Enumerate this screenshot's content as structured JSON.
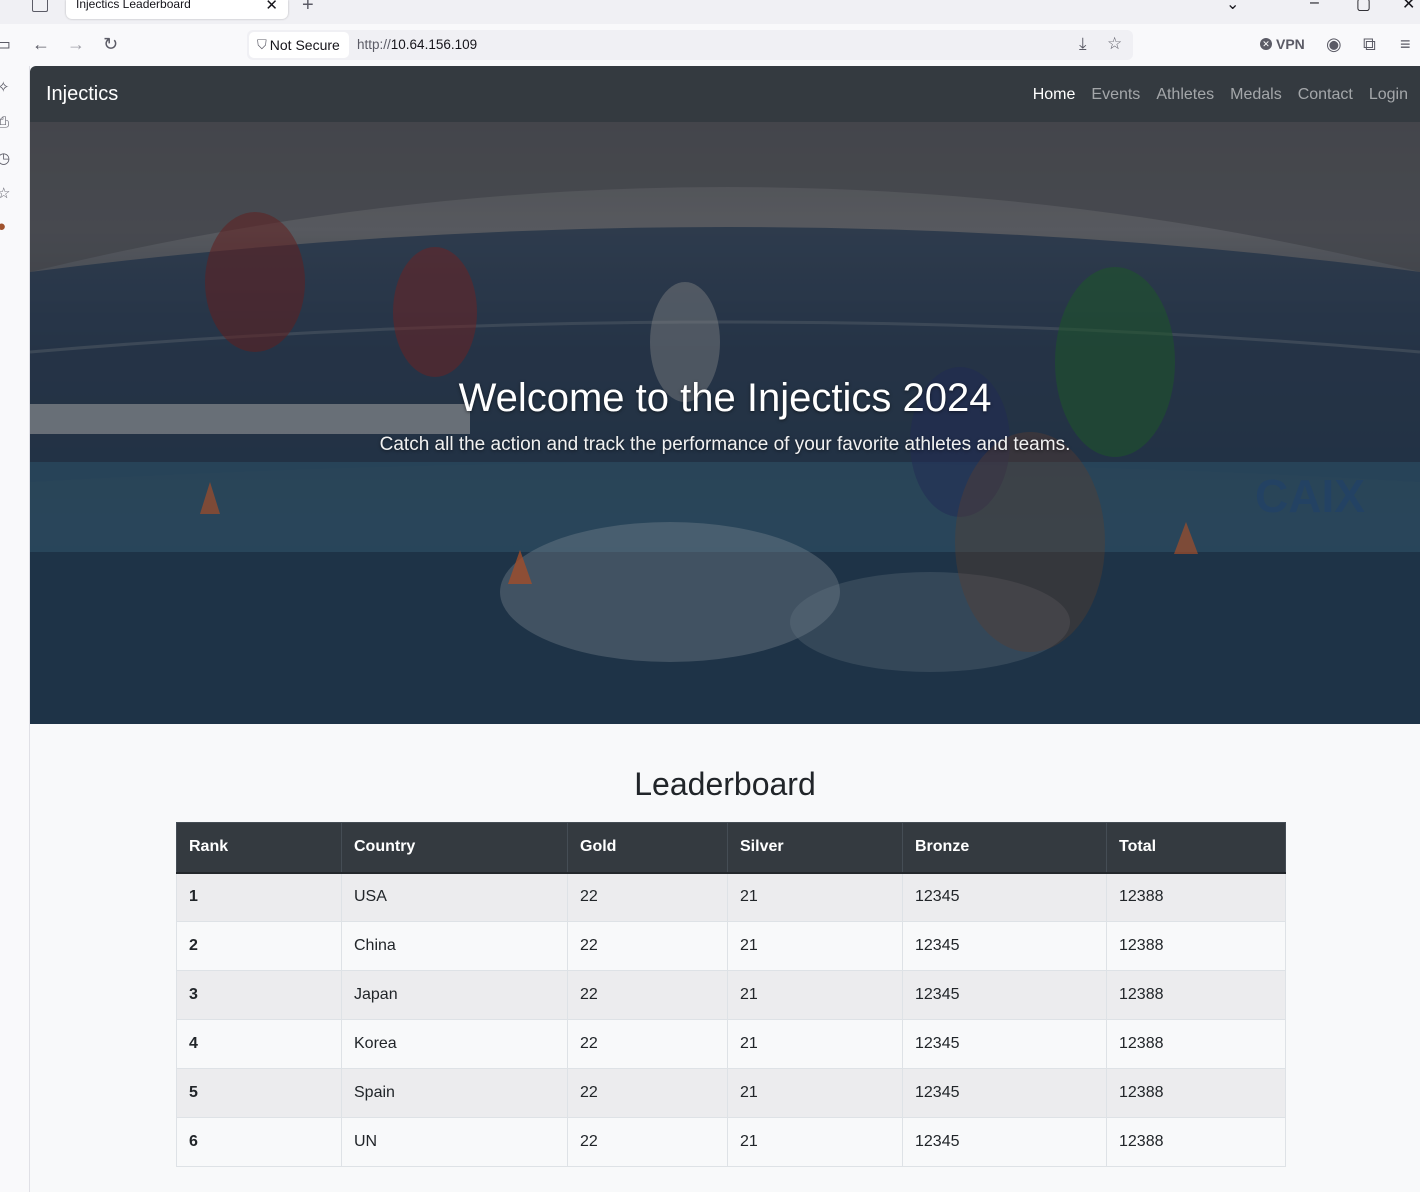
{
  "browser": {
    "tab_title": "Injectics Leaderboard",
    "security_label": "Not Secure",
    "url_scheme": "http://",
    "url_host": "10.64.156.109",
    "vpn_label": "VPN"
  },
  "navbar": {
    "brand": "Injectics",
    "links": [
      "Home",
      "Events",
      "Athletes",
      "Medals",
      "Contact",
      "Login"
    ],
    "active": "Home"
  },
  "hero": {
    "title": "Welcome to the Injectics 2024",
    "subtitle": "Catch all the action and track the performance of your favorite athletes and teams."
  },
  "leaderboard": {
    "title": "Leaderboard",
    "columns": [
      "Rank",
      "Country",
      "Gold",
      "Silver",
      "Bronze",
      "Total"
    ],
    "rows": [
      [
        "1",
        "USA",
        "22",
        "21",
        "12345",
        "12388"
      ],
      [
        "2",
        "China",
        "22",
        "21",
        "12345",
        "12388"
      ],
      [
        "3",
        "Japan",
        "22",
        "21",
        "12345",
        "12388"
      ],
      [
        "4",
        "Korea",
        "22",
        "21",
        "12345",
        "12388"
      ],
      [
        "5",
        "Spain",
        "22",
        "21",
        "12345",
        "12388"
      ],
      [
        "6",
        "UN",
        "22",
        "21",
        "12345",
        "12388"
      ]
    ]
  },
  "colors": {
    "navbar_bg": "#343a40",
    "table_header_bg": "#343a40",
    "stripe": "#ececee"
  }
}
